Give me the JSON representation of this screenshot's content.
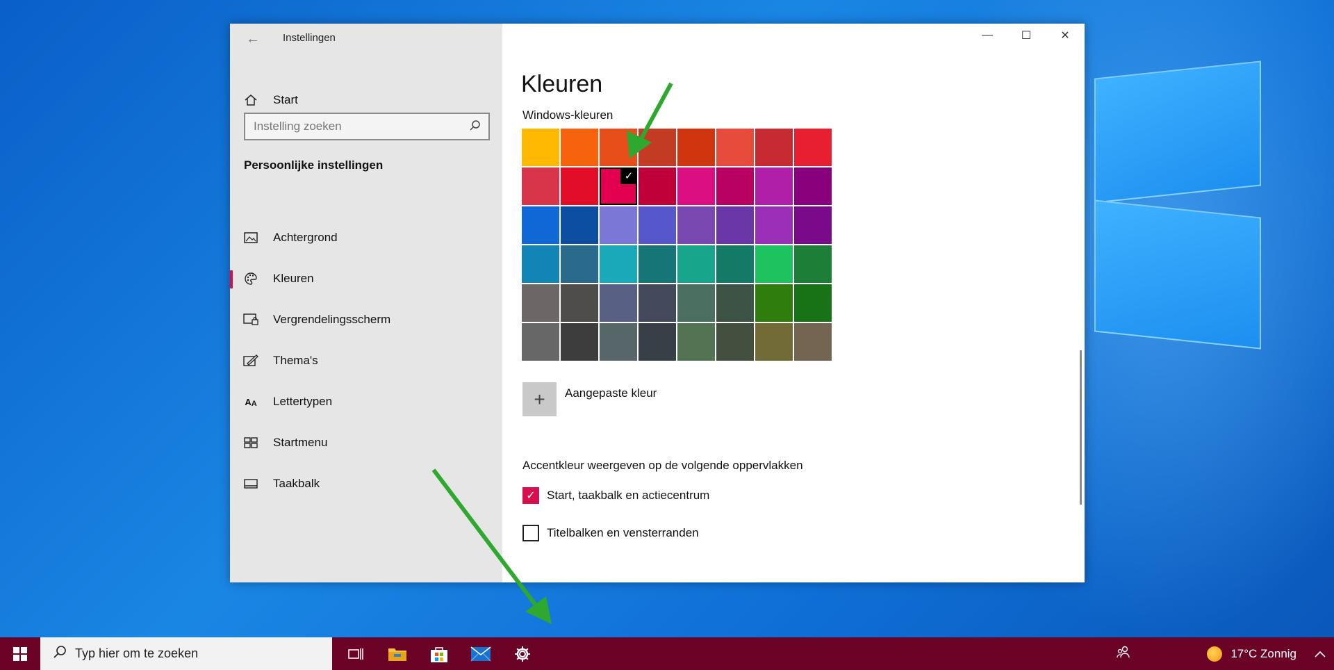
{
  "window": {
    "app_title": "Instellingen",
    "caption": {
      "minimize": "—",
      "maximize": "☐",
      "close": "✕"
    }
  },
  "sidebar": {
    "home": "Start",
    "search_placeholder": "Instelling zoeken",
    "section": "Persoonlijke instellingen",
    "items": [
      {
        "label": "Achtergrond",
        "icon": "image-icon"
      },
      {
        "label": "Kleuren",
        "icon": "palette-icon",
        "active": true
      },
      {
        "label": "Vergrendelingsscherm",
        "icon": "lock-screen-icon"
      },
      {
        "label": "Thema's",
        "icon": "theme-icon"
      },
      {
        "label": "Lettertypen",
        "icon": "font-icon"
      },
      {
        "label": "Startmenu",
        "icon": "start-menu-icon"
      },
      {
        "label": "Taakbalk",
        "icon": "taskbar-icon"
      }
    ]
  },
  "main": {
    "title": "Kleuren",
    "windows_colors_label": "Windows-kleuren",
    "swatches": [
      "#FFB900",
      "#F7630C",
      "#E74E1A",
      "#C23B22",
      "#D13510",
      "#E74B3C",
      "#C72B31",
      "#E81F31",
      "#D8344A",
      "#E20E28",
      "#E3004F",
      "#BF0039",
      "#DC0F82",
      "#B90063",
      "#B01FA8",
      "#89007C",
      "#1068D6",
      "#0C4EA2",
      "#7B77D6",
      "#5657CB",
      "#7948B0",
      "#6B36A8",
      "#9B2FB7",
      "#7A0A8A",
      "#1284B6",
      "#2A6A8C",
      "#1AA9B9",
      "#167677",
      "#17A58C",
      "#137A65",
      "#1EC25F",
      "#1D7E37",
      "#6C6666",
      "#4E4D4B",
      "#586083",
      "#444A5B",
      "#4B6F60",
      "#3D5345",
      "#2F7D0C",
      "#187316",
      "#676767",
      "#3D3D3D",
      "#566669",
      "#383F47",
      "#527453",
      "#43503F",
      "#726B38",
      "#736552"
    ],
    "selected_index": 10,
    "custom_color_label": "Aangepaste kleur",
    "surfaces_heading": "Accentkleur weergeven op de volgende oppervlakken",
    "checkboxes": [
      {
        "label": "Start, taakbalk en actiecentrum",
        "checked": true
      },
      {
        "label": "Titelbalken en vensterranden",
        "checked": false
      }
    ]
  },
  "taskbar": {
    "search_placeholder": "Typ hier om te zoeken",
    "apps": [
      "task-view-icon",
      "file-explorer-icon",
      "store-icon",
      "mail-icon",
      "settings-icon"
    ],
    "weather": "17°C  Zonnig",
    "accent": "#6B0327"
  }
}
